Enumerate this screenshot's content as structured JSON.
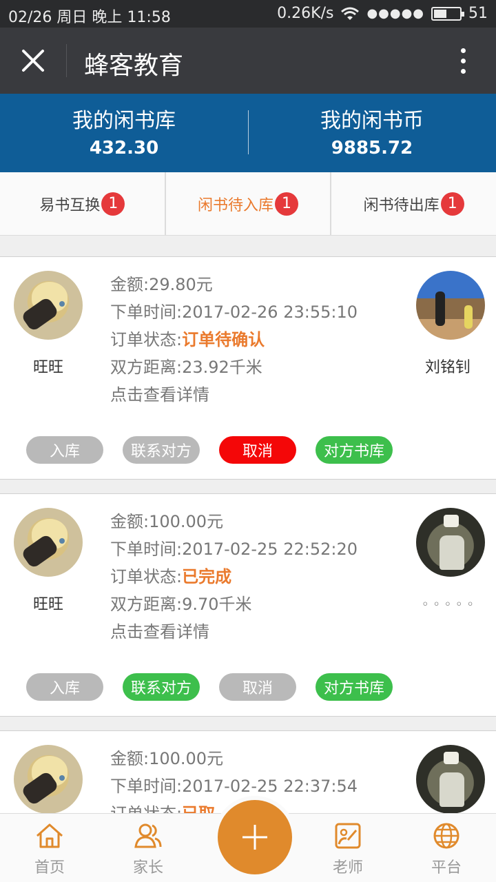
{
  "status_bar": {
    "date": "02/26",
    "weekday": "周日",
    "period": "晚上",
    "time": "11:58",
    "speed": "0.26K/s",
    "signal": "●●●●●",
    "battery_level": 51,
    "battery_text": "51"
  },
  "titlebar": {
    "title": "蜂客教育"
  },
  "banner": {
    "library_label": "我的闲书库",
    "library_value": "432.30",
    "coins_label": "我的闲书币",
    "coins_value": "9885.72"
  },
  "tabs": [
    {
      "label": "易书互换",
      "badge": "1",
      "active": false
    },
    {
      "label": "闲书待入库",
      "badge": "1",
      "active": true
    },
    {
      "label": "闲书待出库",
      "badge": "1",
      "active": false
    }
  ],
  "orders": [
    {
      "me_name": "旺旺",
      "other_name": "刘铭钊",
      "amount_label": "金额:",
      "amount": "29.80元",
      "time_label": "下单时间:",
      "time": "2017-02-26 23:55:10",
      "status_label": "订单状态:",
      "status": "订单待确认",
      "distance_label": "双方距离:",
      "distance": "23.92千米",
      "detail": "点击查看详情",
      "buttons": [
        {
          "label": "入库",
          "color": "gray"
        },
        {
          "label": "联系对方",
          "color": "gray"
        },
        {
          "label": "取消",
          "color": "red"
        },
        {
          "label": "对方书库",
          "color": "green"
        }
      ]
    },
    {
      "me_name": "旺旺",
      "other_name": "◦ ◦ ◦ ◦ ◦",
      "amount_label": "金额:",
      "amount": "100.00元",
      "time_label": "下单时间:",
      "time": "2017-02-25 22:52:20",
      "status_label": "订单状态:",
      "status": "已完成",
      "distance_label": "双方距离:",
      "distance": "9.70千米",
      "detail": "点击查看详情",
      "buttons": [
        {
          "label": "入库",
          "color": "gray"
        },
        {
          "label": "联系对方",
          "color": "green"
        },
        {
          "label": "取消",
          "color": "gray"
        },
        {
          "label": "对方书库",
          "color": "green"
        }
      ]
    },
    {
      "amount_label": "金额:",
      "amount": "100.00元",
      "time_label": "下单时间:",
      "time": "2017-02-25 22:37:54",
      "status_label": "订单状态:",
      "status": "已取"
    }
  ],
  "bottom_nav": {
    "home": "首页",
    "parents": "家长",
    "teachers": "老师",
    "platform": "平台"
  },
  "colors": {
    "banner": "#0f5d97",
    "accent_orange": "#ea7a2d",
    "badge_red": "#e5393b",
    "btn_green": "#3dbf4c",
    "btn_red": "#f40708",
    "btn_gray": "#b9b9b9"
  }
}
